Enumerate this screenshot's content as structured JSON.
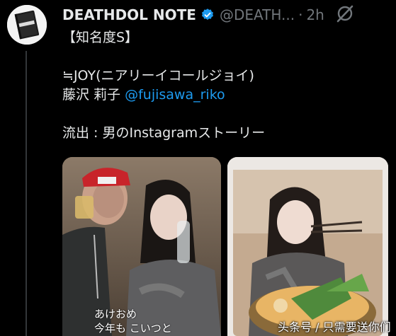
{
  "account": {
    "display_name": "DEATHDOL NOTE",
    "handle": "@DEATH...",
    "separator": "·",
    "time": "2h"
  },
  "tweet": {
    "line1": "【知名度S】",
    "line2": "≒JOY(ニアリーイコールジョイ)",
    "line3_name": "藤沢 莉子 ",
    "line3_mention": "@fujisawa_riko",
    "line4": "流出 : 男のInstagramストーリー"
  },
  "media": {
    "caption_line1": "あけおめ",
    "caption_line2": "今年も こいつと"
  },
  "watermark": "头条号 / 只需要送你们",
  "icons": {
    "avatar": "notebook-avatar-icon",
    "verified": "verified-badge-icon",
    "grok": "grok-icon"
  },
  "colors": {
    "background": "#000000",
    "text": "#e7e9ea",
    "muted": "#71767b",
    "accent": "#1d9bf0"
  }
}
